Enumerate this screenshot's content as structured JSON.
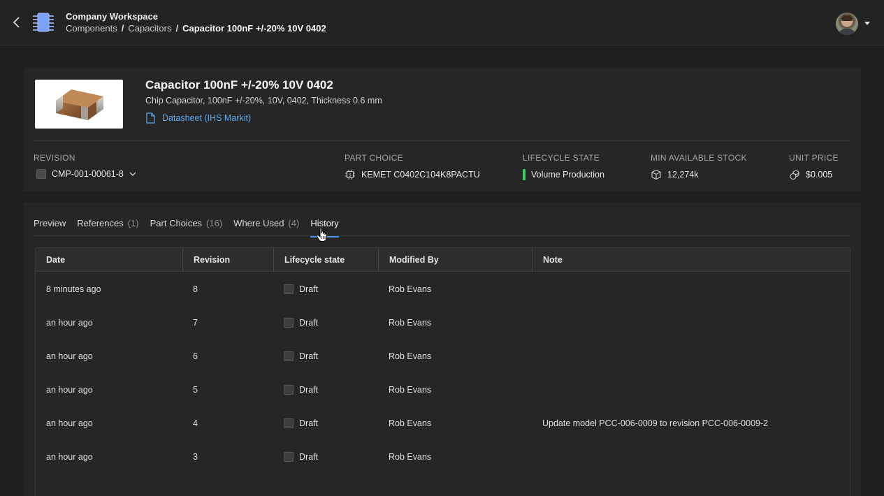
{
  "header": {
    "workspace_name": "Company Workspace",
    "breadcrumb": [
      "Components",
      "Capacitors",
      "Capacitor 100nF +/-20% 10V 0402"
    ],
    "separator": "/"
  },
  "part": {
    "title": "Capacitor 100nF +/-20% 10V 0402",
    "description": "Chip Capacitor, 100nF +/-20%, 10V, 0402, Thickness 0.6 mm",
    "datasheet_label": "Datasheet (IHS Markit)"
  },
  "meta": {
    "revision": {
      "label": "REVISION",
      "value": "CMP-001-00061-8"
    },
    "part_choice": {
      "label": "PART CHOICE",
      "value": "KEMET C0402C104K8PACTU"
    },
    "lifecycle": {
      "label": "LIFECYCLE STATE",
      "value": "Volume Production",
      "color": "#3ccf5f"
    },
    "stock": {
      "label": "MIN AVAILABLE STOCK",
      "value": "12,274k"
    },
    "price": {
      "label": "UNIT PRICE",
      "value": "$0.005"
    }
  },
  "tabs": [
    {
      "label": "Preview",
      "count": ""
    },
    {
      "label": "References",
      "count": "(1)"
    },
    {
      "label": "Part Choices",
      "count": "(16)"
    },
    {
      "label": "Where Used",
      "count": "(4)"
    },
    {
      "label": "History",
      "count": "",
      "active": true
    }
  ],
  "history": {
    "columns": [
      "Date",
      "Revision",
      "Lifecycle state",
      "Modified By",
      "Note"
    ],
    "rows": [
      {
        "date": "8 minutes ago",
        "revision": "8",
        "state": "Draft",
        "modified_by": "Rob Evans",
        "note": ""
      },
      {
        "date": "an hour ago",
        "revision": "7",
        "state": "Draft",
        "modified_by": "Rob Evans",
        "note": ""
      },
      {
        "date": "an hour ago",
        "revision": "6",
        "state": "Draft",
        "modified_by": "Rob Evans",
        "note": ""
      },
      {
        "date": "an hour ago",
        "revision": "5",
        "state": "Draft",
        "modified_by": "Rob Evans",
        "note": ""
      },
      {
        "date": "an hour ago",
        "revision": "4",
        "state": "Draft",
        "modified_by": "Rob Evans",
        "note": "Update model PCC-006-0009 to revision PCC-006-0009-2"
      },
      {
        "date": "an hour ago",
        "revision": "3",
        "state": "Draft",
        "modified_by": "Rob Evans",
        "note": ""
      }
    ]
  },
  "colors": {
    "accent": "#4a8ee8",
    "link": "#5aaaf0",
    "logo": "#7aa2f7"
  }
}
